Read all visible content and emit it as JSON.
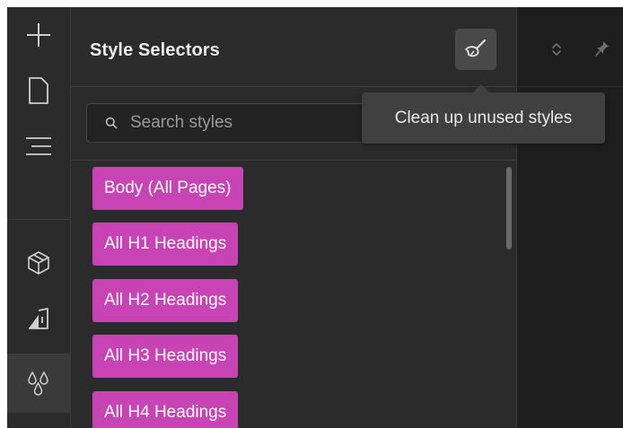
{
  "rail": {
    "items": [
      {
        "icon": "plus-icon"
      },
      {
        "icon": "page-icon"
      },
      {
        "icon": "navigator-icon"
      },
      {
        "icon": "box-icon"
      },
      {
        "icon": "paint-bucket-icon"
      },
      {
        "icon": "droplets-icon",
        "active": true
      }
    ]
  },
  "panel": {
    "title": "Style Selectors",
    "clean_button_icon": "broom-icon",
    "search": {
      "placeholder": "Search styles",
      "value": ""
    },
    "styles": [
      {
        "label": "Body (All Pages)",
        "color": "#c844b4"
      },
      {
        "label": "All H1 Headings",
        "color": "#c844b4"
      },
      {
        "label": "All H2 Headings",
        "color": "#c844b4"
      },
      {
        "label": "All H3 Headings",
        "color": "#c844b4"
      },
      {
        "label": "All H4 Headings",
        "color": "#c844b4"
      }
    ]
  },
  "tooltip": {
    "text": "Clean up unused styles"
  },
  "right_header": {
    "icons": [
      "expand-collapse-icon",
      "pin-icon"
    ]
  },
  "colors": {
    "rail_bg": "#2b2b2b",
    "panel_bg": "#2b2b2b",
    "canvas_bg": "#1e1e1e",
    "style_tag": "#c844b4",
    "tooltip_bg": "#404040"
  }
}
